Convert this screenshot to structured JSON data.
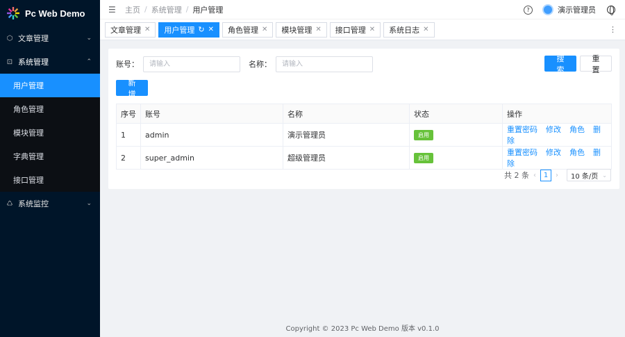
{
  "app": {
    "title": "Pc Web Demo"
  },
  "sidebar": {
    "groups": [
      {
        "label": "文章管理",
        "icon": "hexagon-icon"
      },
      {
        "label": "系统管理",
        "icon": "settings-box-icon",
        "items": [
          {
            "label": "用户管理",
            "active": true
          },
          {
            "label": "角色管理"
          },
          {
            "label": "模块管理"
          },
          {
            "label": "字典管理"
          },
          {
            "label": "接口管理"
          }
        ]
      },
      {
        "label": "系统监控",
        "icon": "recycle-icon"
      }
    ]
  },
  "header": {
    "breadcrumb": [
      "主页",
      "系统管理",
      "用户管理"
    ],
    "separator": "/",
    "user": "演示管理员"
  },
  "tabs": [
    {
      "label": "文章管理"
    },
    {
      "label": "用户管理",
      "active": true
    },
    {
      "label": "角色管理"
    },
    {
      "label": "模块管理"
    },
    {
      "label": "接口管理"
    },
    {
      "label": "系统日志"
    }
  ],
  "search": {
    "account_label": "账号",
    "account_placeholder": "请输入",
    "name_label": "名称",
    "name_placeholder": "请输入",
    "search_button": "搜 索",
    "reset_button": "重 置",
    "add_button": "新 增"
  },
  "table": {
    "columns": [
      "序号",
      "账号",
      "名称",
      "状态",
      "操作"
    ],
    "rows": [
      {
        "index": "1",
        "account": "admin",
        "name": "演示管理员",
        "status": "启用"
      },
      {
        "index": "2",
        "account": "super_admin",
        "name": "超级管理员",
        "status": "启用"
      }
    ],
    "actions": [
      "重置密码",
      "修改",
      "角色",
      "删除"
    ]
  },
  "pagination": {
    "total": "共 2 条",
    "current_page": "1",
    "page_size": "10 条/页"
  },
  "footer": {
    "copyright": "Copyright © 2023 Pc Web Demo 版本 v0.1.0"
  },
  "colors": {
    "sidebar_bg": "#001529",
    "accent": "#1890ff",
    "status_green": "#67c23a"
  }
}
